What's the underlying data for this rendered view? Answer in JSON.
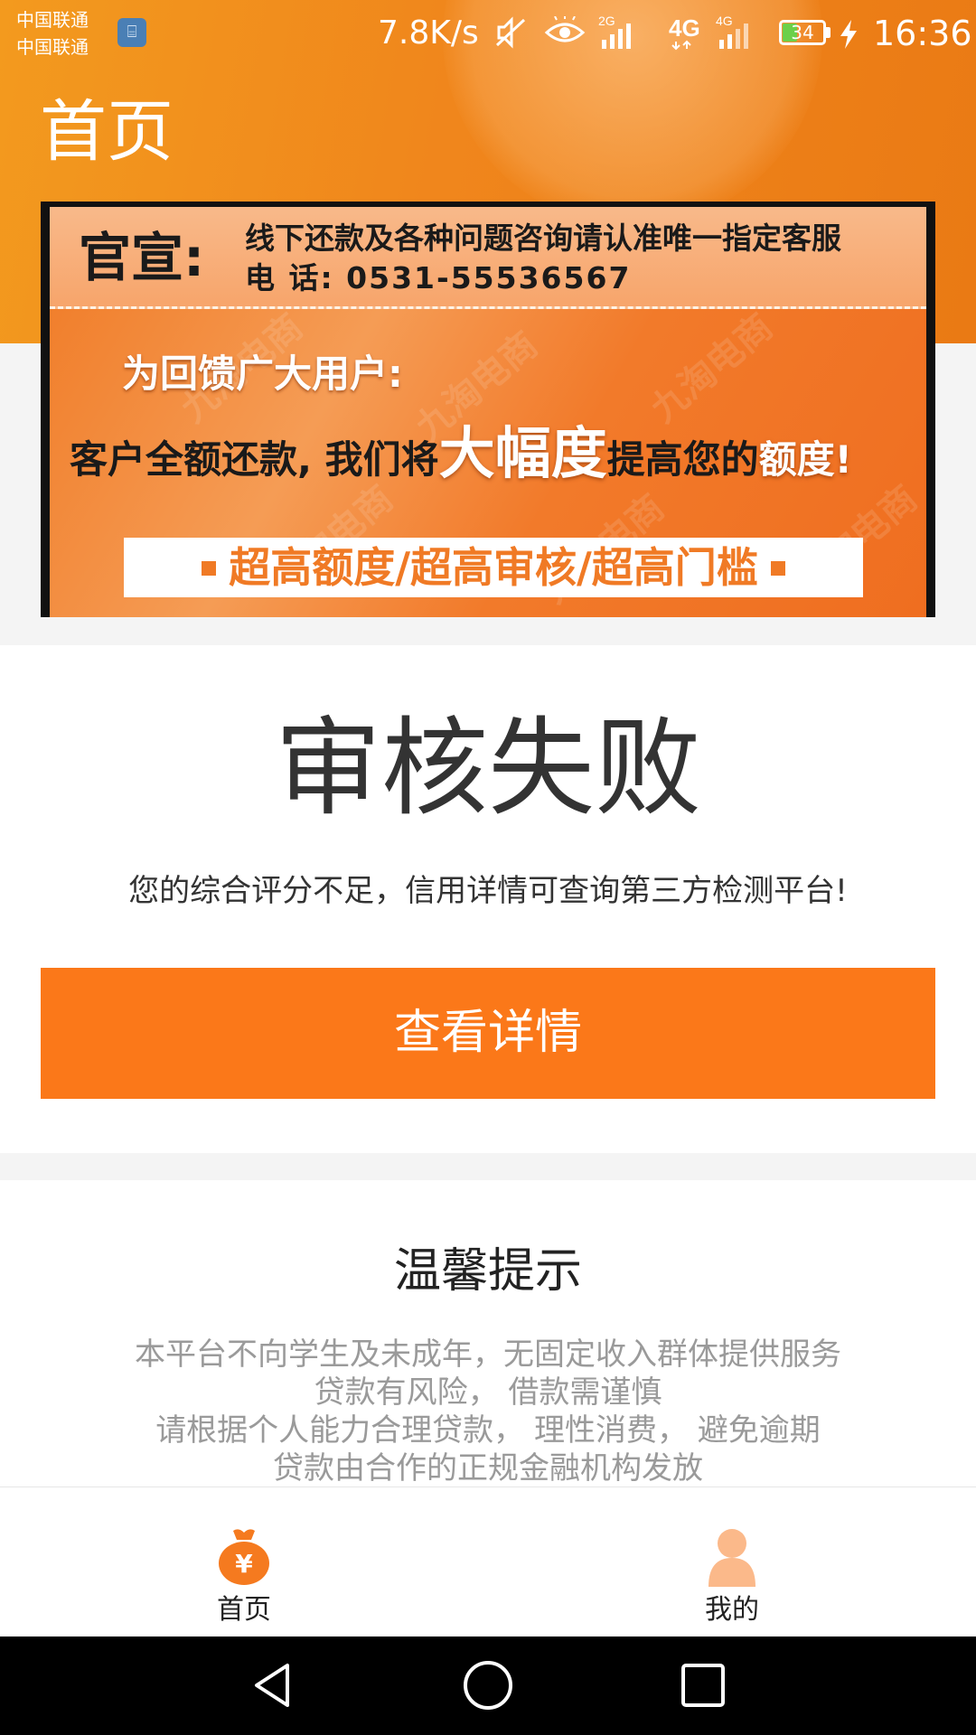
{
  "status_bar": {
    "carrier1": "中国联通",
    "carrier2": "中国联通",
    "sim_label": "⌸",
    "net_speed": "7.8K/s",
    "signal1_label": "2G",
    "signal2_label": "4G",
    "signal3_label": "4G",
    "battery_level": "34",
    "battery_fraction": 0.34,
    "time": "16:36"
  },
  "header": {
    "title": "首页"
  },
  "banner": {
    "badge": "官宣:",
    "notice": "线下还款及各种问题咨询请认准唯一指定客服",
    "phone": "电 话: 0531-55536567",
    "line1": "为回馈广大用户:",
    "line2_part1": "客户全额还款, 我们将",
    "line2_big": "大幅度",
    "line2_part2": "提高您的",
    "line2_part3": "额度!",
    "strip": "超高额度/超高审核/超高门槛",
    "watermark": "九淘电商"
  },
  "result": {
    "title": "审核失败",
    "description": "您的综合评分不足，信用详情可查询第三方检测平台!",
    "button_label": "查看详情"
  },
  "tips": {
    "title": "温馨提示",
    "lines": [
      "本平台不向学生及未成年，无固定收入群体提供服务",
      "贷款有风险， 借款需谨慎",
      "请根据个人能力合理贷款， 理性消费， 避免逾期",
      "贷款由合作的正规金融机构发放"
    ]
  },
  "tab_bar": {
    "items": [
      {
        "label": "首页",
        "icon": "money-bag-icon",
        "active": true
      },
      {
        "label": "我的",
        "icon": "user-icon",
        "active": false
      }
    ]
  },
  "colors": {
    "brand_orange": "#fb7819",
    "header_orange": "#f0861c",
    "text_dark": "#333333",
    "text_muted": "#9a9a9a",
    "tab_icon_active": "#f57a1f",
    "tab_icon_inactive": "#fbb98a"
  }
}
